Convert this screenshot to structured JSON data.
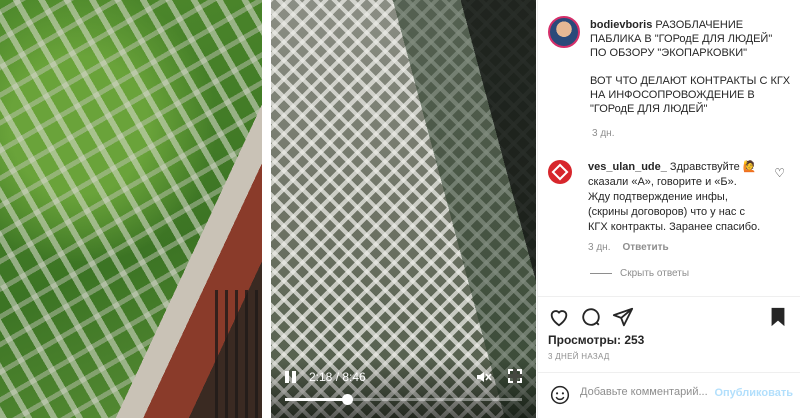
{
  "video": {
    "time": "2:18 / 8:46",
    "progress": 0.263
  },
  "post": {
    "username": "bodievboris",
    "caption_lines": [
      "РАЗОБЛАЧЕНИЕ",
      "ПАБЛИКА В \"ГОРодЕ ДЛЯ ЛЮДЕЙ\"",
      "ПО ОБЗОРУ \"ЭКОПАРКОВКИ\""
    ],
    "caption_lines2": [
      "ВОТ ЧТО ДЕЛАЮТ КОНТРАКТЫ С КГХ",
      "НА ИНФОСОПРОВОЖДЕНИЕ В",
      "\"ГОРодЕ ДЛЯ ЛЮДЕЙ\""
    ],
    "time": "3 дн."
  },
  "comment": {
    "username": "ves_ulan_ude_",
    "text_line1": " Здравствуйте 🙋",
    "lines": [
      "сказали «А», говорите и «Б».",
      "Жду подтверждение инфы,",
      "(скрины договоров) что у нас с",
      "КГХ контракты. Заранее спасибо."
    ],
    "time": "3 дн.",
    "reply_label": "Ответить",
    "hide_replies_label": "Скрыть ответы"
  },
  "stats": {
    "views_label": "Просмотры: 253",
    "date": "3 ДНЕЙ НАЗАД"
  },
  "add_comment": {
    "placeholder": "Добавьте комментарий...",
    "publish_label": "Опубликовать"
  },
  "icons": {
    "like": "heart-icon",
    "comment": "comment-bubble-icon",
    "share": "paper-plane-icon",
    "save": "bookmark-icon",
    "emoji": "smiley-icon"
  }
}
